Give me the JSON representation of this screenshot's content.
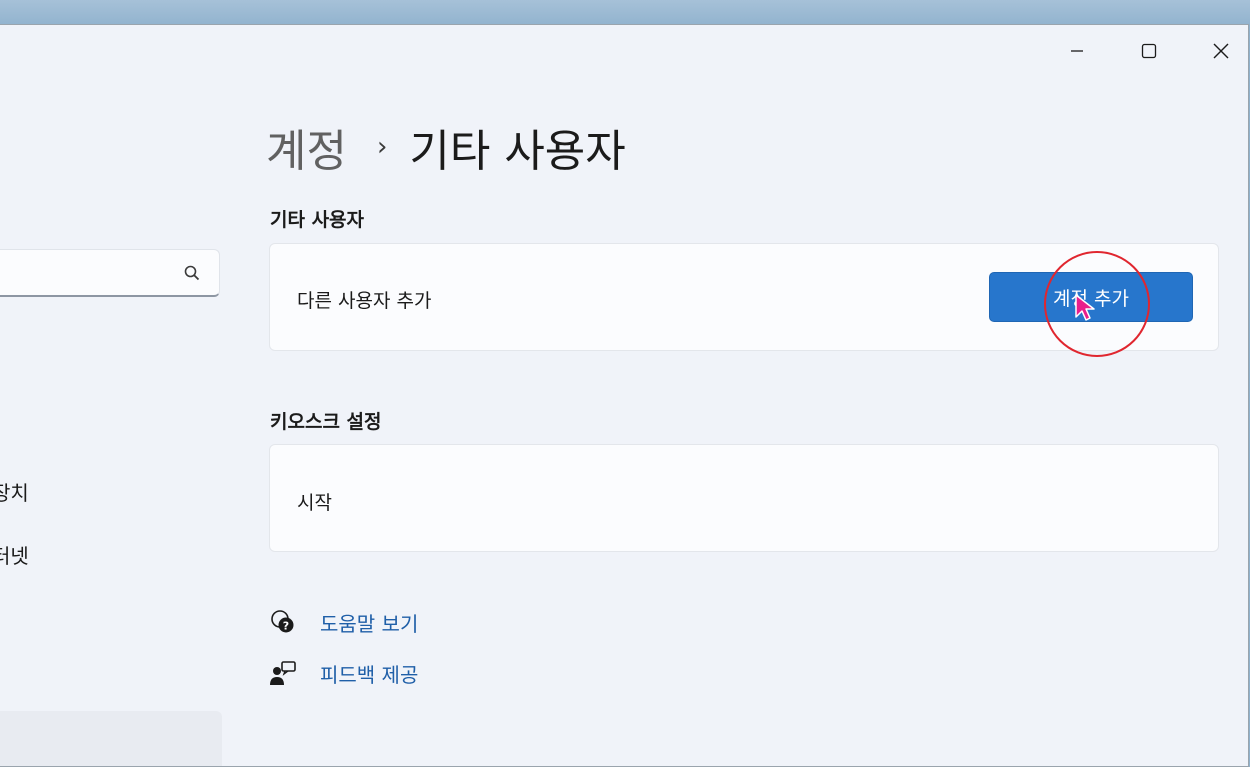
{
  "window": {
    "controls": {
      "minimize": "minimize-icon",
      "maximize": "maximize-icon",
      "close": "close-icon"
    }
  },
  "sidebar": {
    "search": {
      "value": "",
      "icon": "search-icon"
    },
    "items": [
      {
        "label": "장치"
      },
      {
        "label": "터넷"
      }
    ]
  },
  "breadcrumb": {
    "parent": "계정",
    "separator": "›",
    "current": "기타 사용자"
  },
  "other_users": {
    "title": "기타 사용자",
    "add_user_label": "다른 사용자 추가",
    "add_account_button": "계정 추가"
  },
  "kiosk": {
    "title": "키오스크 설정",
    "start_label": "시작"
  },
  "links": {
    "help": "도움말 보기",
    "feedback": "피드백 제공"
  },
  "colors": {
    "accent": "#2776cc",
    "link": "#1f5fa8",
    "annotation": "#e0262f",
    "cursor": "#e91e8c"
  }
}
